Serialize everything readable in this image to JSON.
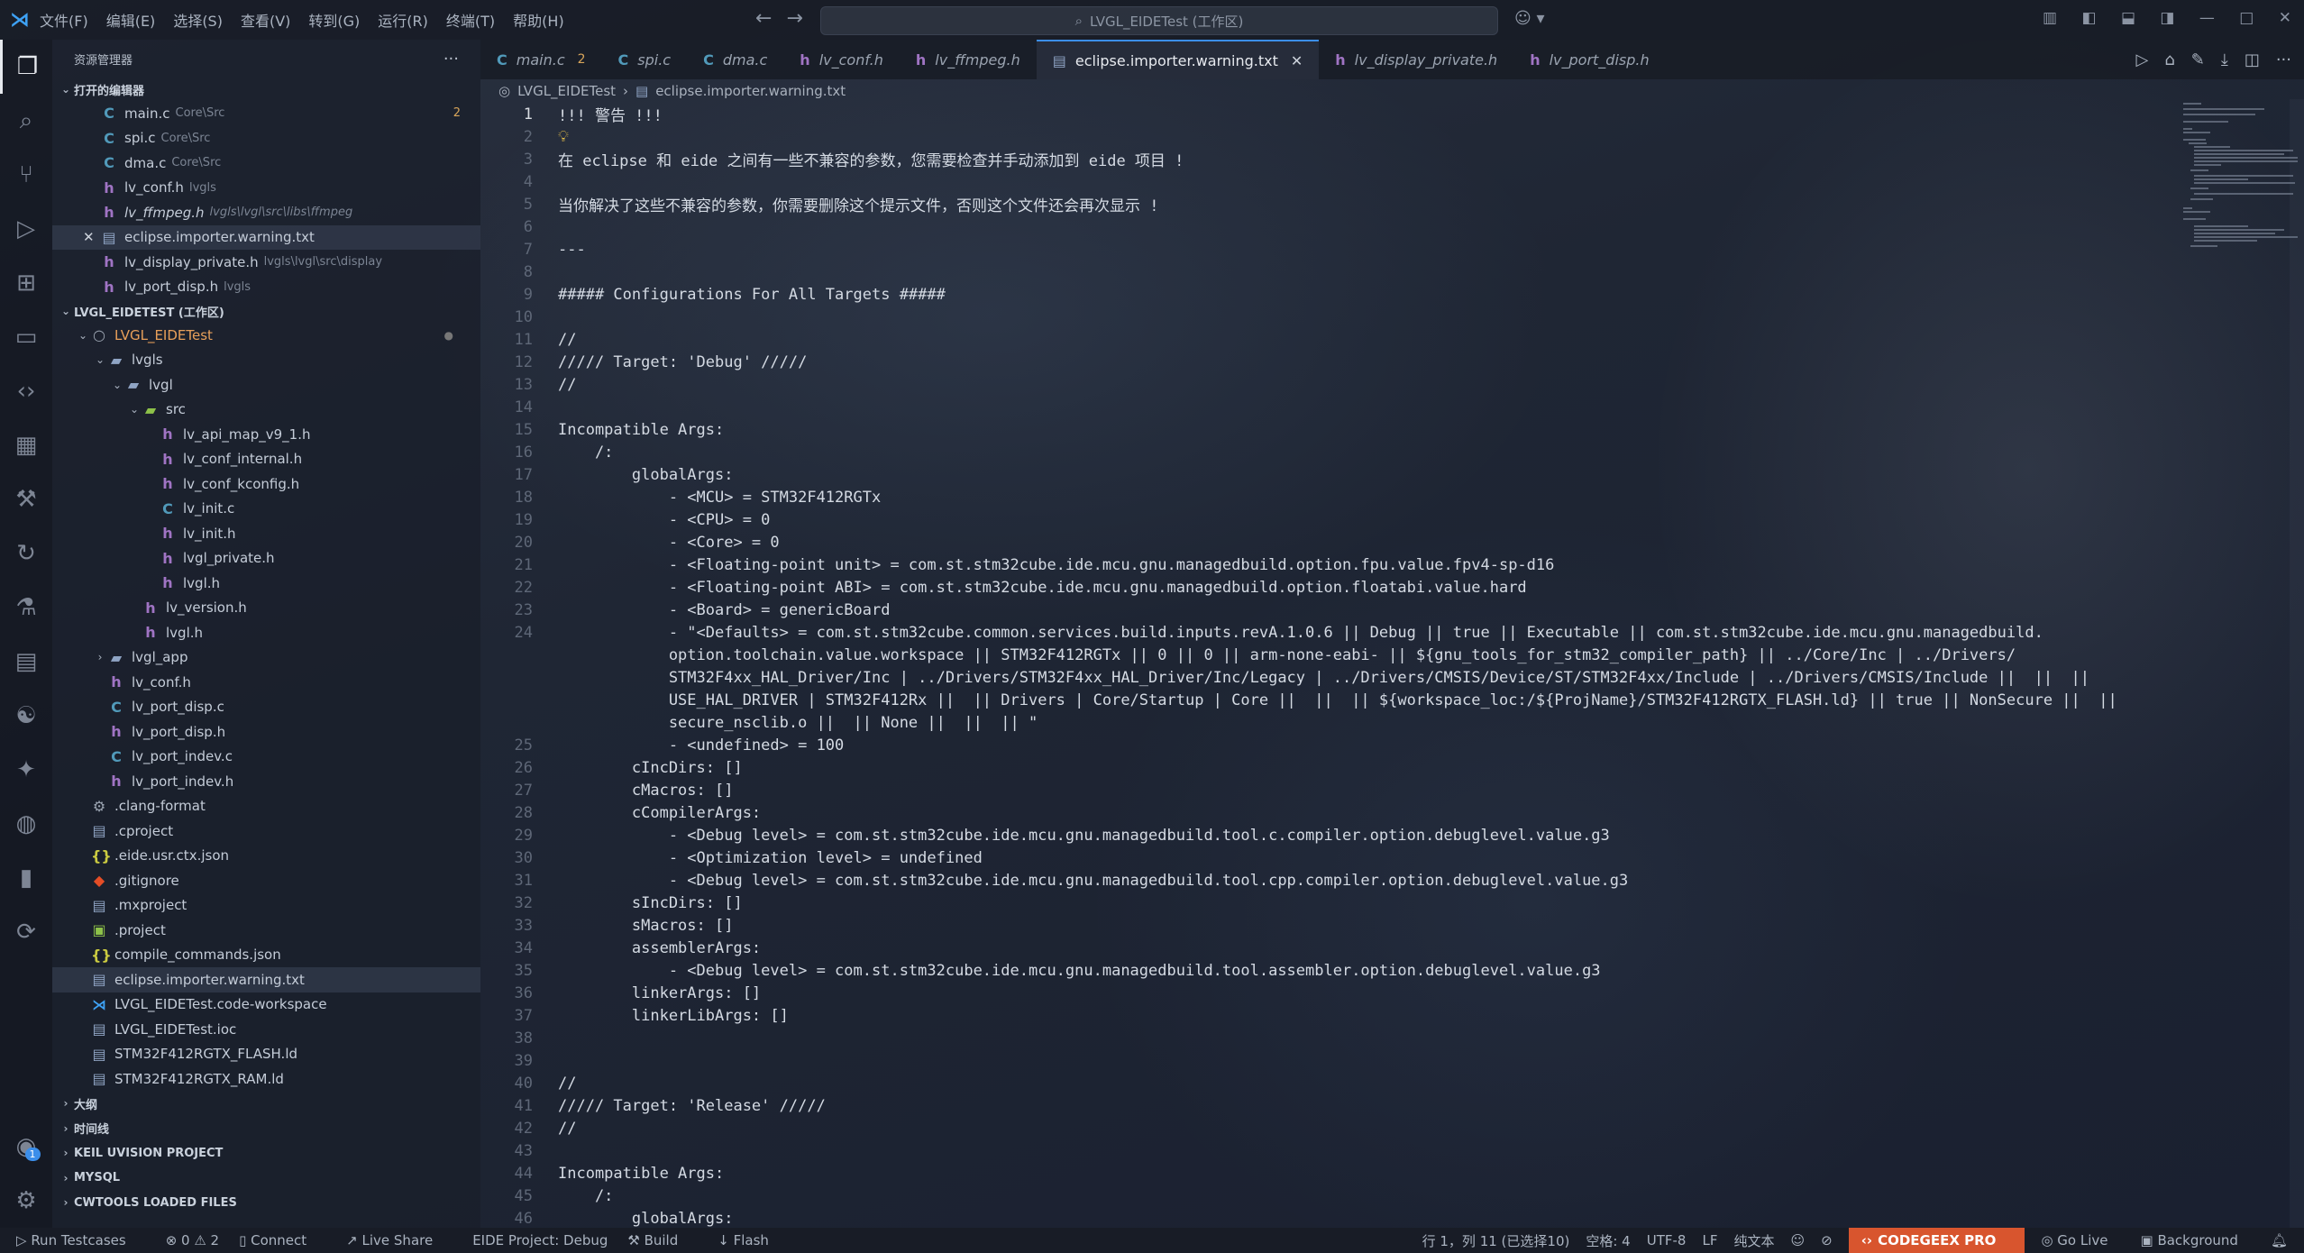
{
  "titlebar": {
    "menu": [
      "文件(F)",
      "编辑(E)",
      "选择(S)",
      "查看(V)",
      "转到(G)",
      "运行(R)",
      "终端(T)",
      "帮助(H)"
    ],
    "search": "LVGL_EIDETest (工作区)"
  },
  "sidebar": {
    "title": "资源管理器",
    "open_editors_title": "打开的编辑器",
    "open_editors": [
      {
        "icon": "C",
        "name": "main.c",
        "desc": "Core\\Src",
        "count": "2"
      },
      {
        "icon": "C",
        "name": "spi.c",
        "desc": "Core\\Src"
      },
      {
        "icon": "C",
        "name": "dma.c",
        "desc": "Core\\Src"
      },
      {
        "icon": "h",
        "name": "lv_conf.h",
        "desc": "lvgls"
      },
      {
        "icon": "h",
        "name": "lv_ffmpeg.h",
        "desc": "lvgls\\lvgl\\src\\libs\\ffmpeg"
      },
      {
        "icon": "txt",
        "name": "eclipse.importer.warning.txt",
        "desc": ""
      },
      {
        "icon": "h",
        "name": "lv_display_private.h",
        "desc": "lvgls\\lvgl\\src\\display"
      },
      {
        "icon": "h",
        "name": "lv_port_disp.h",
        "desc": "lvgls"
      }
    ],
    "workspace_title": "LVGL_EIDETEST (工作区)",
    "tree": [
      {
        "indent": 1,
        "chev": "v",
        "icon": "proj",
        "name": "LVGL_EIDETest"
      },
      {
        "indent": 2,
        "chev": "v",
        "icon": "folder",
        "name": "lvgls"
      },
      {
        "indent": 3,
        "chev": "v",
        "icon": "folder",
        "name": "lvgl"
      },
      {
        "indent": 4,
        "chev": "v",
        "icon": "src",
        "name": "src"
      },
      {
        "indent": 5,
        "icon": "h",
        "name": "lv_api_map_v9_1.h"
      },
      {
        "indent": 5,
        "icon": "h",
        "name": "lv_conf_internal.h"
      },
      {
        "indent": 5,
        "icon": "h",
        "name": "lv_conf_kconfig.h"
      },
      {
        "indent": 5,
        "icon": "C",
        "name": "lv_init.c"
      },
      {
        "indent": 5,
        "icon": "h",
        "name": "lv_init.h"
      },
      {
        "indent": 5,
        "icon": "h",
        "name": "lvgl_private.h"
      },
      {
        "indent": 5,
        "icon": "h",
        "name": "lvgl.h"
      },
      {
        "indent": 4,
        "icon": "h",
        "name": "lv_version.h"
      },
      {
        "indent": 4,
        "icon": "h",
        "name": "lvgl.h"
      },
      {
        "indent": 2,
        "chev": ">",
        "icon": "folder",
        "name": "lvgl_app"
      },
      {
        "indent": 2,
        "icon": "h",
        "name": "lv_conf.h"
      },
      {
        "indent": 2,
        "icon": "C",
        "name": "lv_port_disp.c"
      },
      {
        "indent": 2,
        "icon": "h",
        "name": "lv_port_disp.h"
      },
      {
        "indent": 2,
        "icon": "C",
        "name": "lv_port_indev.c"
      },
      {
        "indent": 2,
        "icon": "h",
        "name": "lv_port_indev.h"
      },
      {
        "indent": 1,
        "icon": "gear",
        "name": ".clang-format"
      },
      {
        "indent": 1,
        "icon": "txt",
        "name": ".cproject"
      },
      {
        "indent": 1,
        "icon": "json",
        "name": ".eide.usr.ctx.json"
      },
      {
        "indent": 1,
        "icon": "git",
        "name": ".gitignore"
      },
      {
        "indent": 1,
        "icon": "txt",
        "name": ".mxproject"
      },
      {
        "indent": 1,
        "icon": "green",
        "name": ".project"
      },
      {
        "indent": 1,
        "icon": "json",
        "name": "compile_commands.json"
      },
      {
        "indent": 1,
        "icon": "txt",
        "name": "eclipse.importer.warning.txt",
        "selected": true
      },
      {
        "indent": 1,
        "icon": "vsc",
        "name": "LVGL_EIDETest.code-workspace"
      },
      {
        "indent": 1,
        "icon": "txt",
        "name": "LVGL_EIDETest.ioc"
      },
      {
        "indent": 1,
        "icon": "txt",
        "name": "STM32F412RGTX_FLASH.ld"
      },
      {
        "indent": 1,
        "icon": "txt",
        "name": "STM32F412RGTX_RAM.ld"
      }
    ],
    "bottom_sections": [
      "大纲",
      "时间线",
      "KEIL UVISION PROJECT",
      "MYSQL",
      "CWTOOLS LOADED FILES"
    ]
  },
  "tabs": [
    {
      "icon": "C",
      "label": "main.c",
      "count": "2"
    },
    {
      "icon": "C",
      "label": "spi.c"
    },
    {
      "icon": "C",
      "label": "dma.c"
    },
    {
      "icon": "h",
      "label": "lv_conf.h"
    },
    {
      "icon": "h",
      "label": "lv_ffmpeg.h"
    },
    {
      "icon": "txt",
      "label": "eclipse.importer.warning.txt",
      "active": true
    },
    {
      "icon": "h",
      "label": "lv_display_private.h"
    },
    {
      "icon": "h",
      "label": "lv_port_disp.h"
    }
  ],
  "breadcrumb": {
    "root": "LVGL_EIDETest",
    "file": "eclipse.importer.warning.txt"
  },
  "editor": {
    "current_line": "1",
    "lines": [
      {
        "n": "1",
        "t": "!!! 警告 !!!"
      },
      {
        "n": "2",
        "t": ""
      },
      {
        "n": "3",
        "t": "在 eclipse 和 eide 之间有一些不兼容的参数，您需要检查并手动添加到 eide 项目 !"
      },
      {
        "n": "4",
        "t": ""
      },
      {
        "n": "5",
        "t": "当你解决了这些不兼容的参数，你需要删除这个提示文件，否则这个文件还会再次显示 !"
      },
      {
        "n": "6",
        "t": ""
      },
      {
        "n": "7",
        "t": "---"
      },
      {
        "n": "8",
        "t": ""
      },
      {
        "n": "9",
        "t": "##### Configurations For All Targets #####"
      },
      {
        "n": "10",
        "t": ""
      },
      {
        "n": "11",
        "t": "//"
      },
      {
        "n": "12",
        "t": "///// Target: 'Debug' /////"
      },
      {
        "n": "13",
        "t": "//"
      },
      {
        "n": "14",
        "t": ""
      },
      {
        "n": "15",
        "t": "Incompatible Args:"
      },
      {
        "n": "16",
        "t": "    /:"
      },
      {
        "n": "17",
        "t": "        globalArgs:"
      },
      {
        "n": "18",
        "t": "            - <MCU> = STM32F412RGTx"
      },
      {
        "n": "19",
        "t": "            - <CPU> = 0"
      },
      {
        "n": "20",
        "t": "            - <Core> = 0"
      },
      {
        "n": "21",
        "t": "            - <Floating-point unit> = com.st.stm32cube.ide.mcu.gnu.managedbuild.option.fpu.value.fpv4-sp-d16"
      },
      {
        "n": "22",
        "t": "            - <Floating-point ABI> = com.st.stm32cube.ide.mcu.gnu.managedbuild.option.floatabi.value.hard"
      },
      {
        "n": "23",
        "t": "            - <Board> = genericBoard"
      },
      {
        "n": "24",
        "t": "            - \"<Defaults> = com.st.stm32cube.common.services.build.inputs.revA.1.0.6 || Debug || true || Executable || com.st.stm32cube.ide.mcu.gnu.managedbuild."
      },
      {
        "n": "",
        "t": "            option.toolchain.value.workspace || STM32F412RGTx || 0 || 0 || arm-none-eabi- || ${gnu_tools_for_stm32_compiler_path} || ../Core/Inc | ../Drivers/"
      },
      {
        "n": "",
        "t": "            STM32F4xx_HAL_Driver/Inc | ../Drivers/STM32F4xx_HAL_Driver/Inc/Legacy | ../Drivers/CMSIS/Device/ST/STM32F4xx/Include | ../Drivers/CMSIS/Include ||  ||  ||"
      },
      {
        "n": "",
        "t": "            USE_HAL_DRIVER | STM32F412Rx ||  || Drivers | Core/Startup | Core ||  ||  || ${workspace_loc:/${ProjName}/STM32F412RGTX_FLASH.ld} || true || NonSecure ||  ||"
      },
      {
        "n": "",
        "t": "            secure_nsclib.o ||  || None ||  ||  || \""
      },
      {
        "n": "25",
        "t": "            - <undefined> = 100"
      },
      {
        "n": "26",
        "t": "        cIncDirs: []"
      },
      {
        "n": "27",
        "t": "        cMacros: []"
      },
      {
        "n": "28",
        "t": "        cCompilerArgs:"
      },
      {
        "n": "29",
        "t": "            - <Debug level> = com.st.stm32cube.ide.mcu.gnu.managedbuild.tool.c.compiler.option.debuglevel.value.g3"
      },
      {
        "n": "30",
        "t": "            - <Optimization level> = undefined"
      },
      {
        "n": "31",
        "t": "            - <Debug level> = com.st.stm32cube.ide.mcu.gnu.managedbuild.tool.cpp.compiler.option.debuglevel.value.g3"
      },
      {
        "n": "32",
        "t": "        sIncDirs: []"
      },
      {
        "n": "33",
        "t": "        sMacros: []"
      },
      {
        "n": "34",
        "t": "        assemblerArgs:"
      },
      {
        "n": "35",
        "t": "            - <Debug level> = com.st.stm32cube.ide.mcu.gnu.managedbuild.tool.assembler.option.debuglevel.value.g3"
      },
      {
        "n": "36",
        "t": "        linkerArgs: []"
      },
      {
        "n": "37",
        "t": "        linkerLibArgs: []"
      },
      {
        "n": "38",
        "t": ""
      },
      {
        "n": "39",
        "t": ""
      },
      {
        "n": "40",
        "t": "//"
      },
      {
        "n": "41",
        "t": "///// Target: 'Release' /////"
      },
      {
        "n": "42",
        "t": "//"
      },
      {
        "n": "43",
        "t": ""
      },
      {
        "n": "44",
        "t": "Incompatible Args:"
      },
      {
        "n": "45",
        "t": "    /:"
      },
      {
        "n": "46",
        "t": "        globalArgs:"
      }
    ]
  },
  "statusbar": {
    "run_testcases": "Run Testcases",
    "problems": "⊗ 0 ⚠ 2",
    "connect": "Connect",
    "live_share": "Live Share",
    "eide_project": "EIDE Project: Debug",
    "build": "Build",
    "flash": "Flash",
    "cursor": "行 1，列 11 (已选择10)",
    "spaces": "空格: 4",
    "encoding": "UTF-8",
    "eol": "LF",
    "language": "纯文本",
    "codegeex": "CODEGEEX PRO",
    "go_live": "Go Live",
    "background": "Background"
  },
  "colors": {
    "accent": "#3b8eea",
    "codegeex": "#d8552e",
    "c_icon": "#519aba",
    "h_icon": "#a074c4"
  }
}
